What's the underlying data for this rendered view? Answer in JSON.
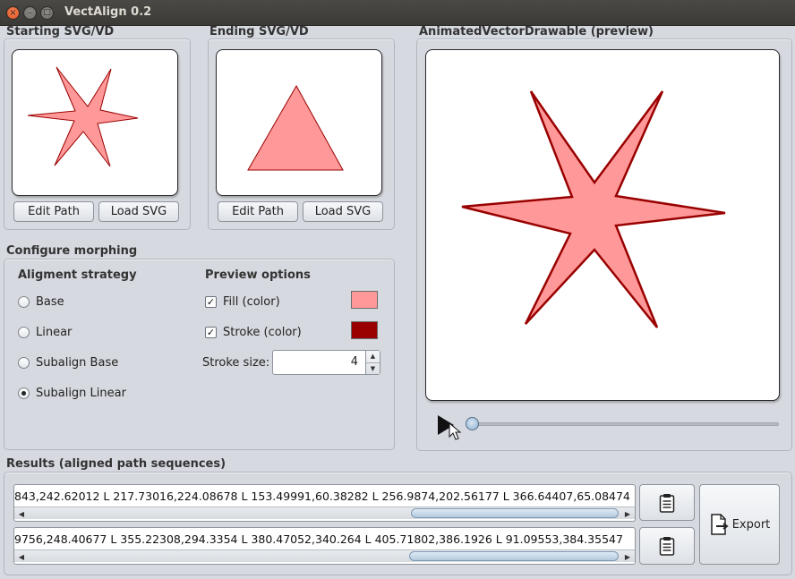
{
  "window": {
    "title": "VectAlign 0.2",
    "close_glyph": "×",
    "minimize_glyph": "–",
    "maximize_glyph": "□"
  },
  "starting": {
    "title": "Starting SVG/VD",
    "edit_label": "Edit Path",
    "load_label": "Load SVG"
  },
  "ending": {
    "title": "Ending SVG/VD",
    "edit_label": "Edit Path",
    "load_label": "Load SVG"
  },
  "preview": {
    "title": "AnimatedVectorDrawable (preview)",
    "play_icon": "play-icon",
    "slider_value": 0
  },
  "config": {
    "title": "Configure morphing",
    "strategy_title": "Aligment strategy",
    "strategies": [
      {
        "label": "Base",
        "selected": false
      },
      {
        "label": "Linear",
        "selected": false
      },
      {
        "label": "Subalign Base",
        "selected": false
      },
      {
        "label": "Subalign Linear",
        "selected": true
      }
    ],
    "preview_title": "Preview options",
    "fill_label": "Fill (color)",
    "fill_checked": true,
    "fill_color": "#ff9999",
    "stroke_label": "Stroke (color)",
    "stroke_checked": true,
    "stroke_color": "#990000",
    "stroke_size_label": "Stroke size:",
    "stroke_size_value": "4"
  },
  "results": {
    "title": "Results (aligned path sequences)",
    "line1": "843,242.62012 L 217.73016,224.08678 L 153.49991,60.38282 L 256.9874,202.56177 L 366.64407,65.08474",
    "line2": "9756,248.40677 L 355.22308,294.3354 L 380.47052,340.264 L 405.71802,386.1926 L 91.09553,384.35547",
    "copy_icon": "clipboard-icon",
    "export_label": "Export"
  }
}
